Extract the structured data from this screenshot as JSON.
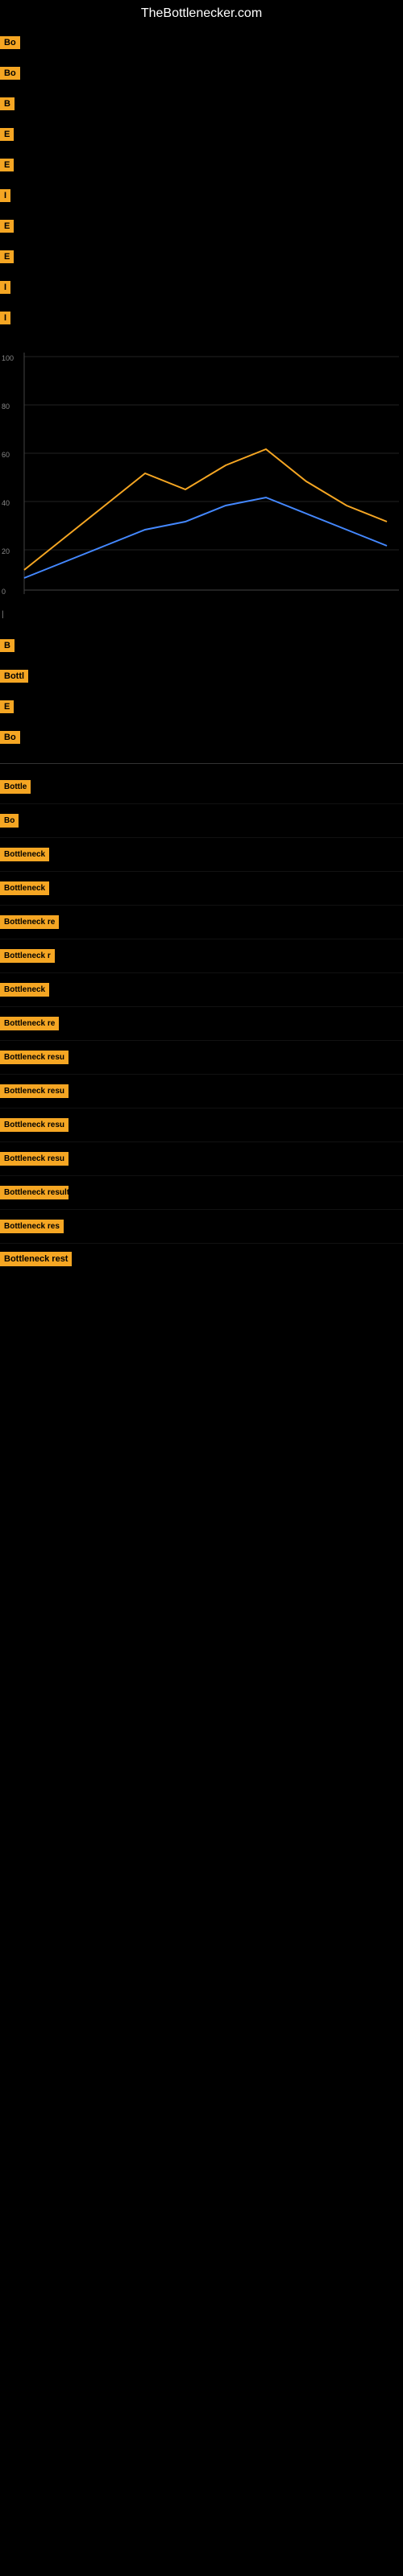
{
  "site": {
    "title": "TheBottlenecker.com"
  },
  "top_badges": [
    {
      "label": "Bo",
      "text": ""
    },
    {
      "label": "Bo",
      "text": ""
    },
    {
      "label": "B",
      "text": ""
    },
    {
      "label": "E",
      "text": ""
    },
    {
      "label": "E",
      "text": ""
    },
    {
      "label": "I",
      "text": ""
    },
    {
      "label": "E",
      "text": ""
    },
    {
      "label": "E",
      "text": ""
    },
    {
      "label": "I",
      "text": ""
    },
    {
      "label": "I",
      "text": ""
    }
  ],
  "chart": {
    "label": "Chart area"
  },
  "bottom_badges": [
    {
      "label": "B",
      "text": ""
    },
    {
      "label": "Bottl",
      "text": ""
    },
    {
      "label": "E",
      "text": ""
    },
    {
      "label": "Bo",
      "text": ""
    }
  ],
  "result_rows": [
    {
      "badge": "Bottle",
      "text": ""
    },
    {
      "badge": "Bo",
      "text": ""
    },
    {
      "badge": "Bottleneck",
      "text": ""
    },
    {
      "badge": "Bottleneck",
      "text": ""
    },
    {
      "badge": "Bottleneck re",
      "text": ""
    },
    {
      "badge": "Bottleneck r",
      "text": ""
    },
    {
      "badge": "Bottleneck",
      "text": ""
    },
    {
      "badge": "Bottleneck re",
      "text": ""
    },
    {
      "badge": "Bottleneck resu",
      "text": ""
    },
    {
      "badge": "Bottleneck resu",
      "text": ""
    },
    {
      "badge": "Bottleneck resu",
      "text": ""
    },
    {
      "badge": "Bottleneck resu",
      "text": ""
    },
    {
      "badge": "Bottleneck result",
      "text": ""
    },
    {
      "badge": "Bottleneck res",
      "text": ""
    }
  ],
  "last_badge": {
    "label": "Bottleneck rest",
    "text": ""
  }
}
